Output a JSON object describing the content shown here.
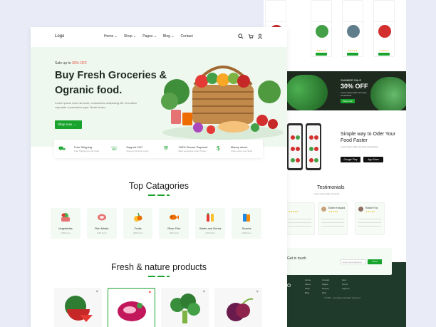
{
  "nav": {
    "logo": "Logo",
    "menu": [
      "Home ⌄",
      "Shop ⌄",
      "Pages ⌄",
      "Blog ⌄",
      "Contact"
    ],
    "icons": [
      "search-icon",
      "cart-icon",
      "user-icon"
    ]
  },
  "hero": {
    "sale_prefix": "Sale up to ",
    "sale_value": "30% OFF",
    "title": "Buy Fresh Groceries & Ogranic food.",
    "paragraph": "Lorem ipsum dolor sit amet, consectetur adipiscing elit. At nullam vulputate consectetur eget. Morbi donec.",
    "button": "Shop now →"
  },
  "features": [
    {
      "title": "Free Shipping",
      "sub": "Free Shipping on All Order",
      "icon": "truck-icon"
    },
    {
      "title": "Support 24/7",
      "sub": "Support 24 hours a day",
      "icon": "headset-icon"
    },
    {
      "title": "100% Secure Payment",
      "sub": "Back guarantee under 5 days",
      "icon": "shield-icon"
    },
    {
      "title": "Money return",
      "sub": "Under order over $100",
      "icon": "money-icon"
    }
  ],
  "categories_section": {
    "title": "Top Catagories",
    "items": [
      {
        "name": "Vegetables",
        "count": "(165 item)",
        "icon": "basket-icon"
      },
      {
        "name": "Fish Meats",
        "count": "(165 item)",
        "icon": "meat-icon"
      },
      {
        "name": "Fruits",
        "count": "(165 item)",
        "icon": "fruits-icon"
      },
      {
        "name": "River Fish",
        "count": "(165 item)",
        "icon": "fish-icon"
      },
      {
        "name": "Water and Drinks",
        "count": "(165 item)",
        "icon": "drinks-icon"
      },
      {
        "name": "Snacks",
        "count": "(165 item)",
        "icon": "snacks-icon"
      }
    ]
  },
  "products_section": {
    "title": "Fresh & nature products",
    "items": [
      {
        "name": "Watermelon",
        "icon": "watermelon-icon"
      },
      {
        "name": "Meat",
        "icon": "meat-icon"
      },
      {
        "name": "Broccoli",
        "icon": "broccoli-icon"
      },
      {
        "name": "Onion",
        "icon": "onion-icon"
      }
    ]
  },
  "back": {
    "promo_small": "SUMMER SALE",
    "promo_big": "30% OFF",
    "promo_text": "Lorem ipsum dolor sit amet, consectetur",
    "promo_button": "Shop now",
    "app_title": "Simple way to Oder Your Food Faster",
    "app_desc": "Lorem ipsum dolor sit amet consectetur",
    "store_google": "Google Play",
    "store_apple": "App Store",
    "testimonials_title": "Testimonials",
    "testimonials_sub": "Lorem ipsum dolor sit amet",
    "testimonial_names": [
      "Esther Howard",
      "Robert Fox"
    ],
    "touch_title": "Get in touch",
    "touch_placeholder": "Enter email address",
    "touch_button": "Send",
    "footer_copy": "© 2021 · Company. All rights reserved"
  },
  "colors": {
    "accent": "#18a32d",
    "sale": "#e74c3c",
    "hero_bg": "#eff8ef"
  }
}
